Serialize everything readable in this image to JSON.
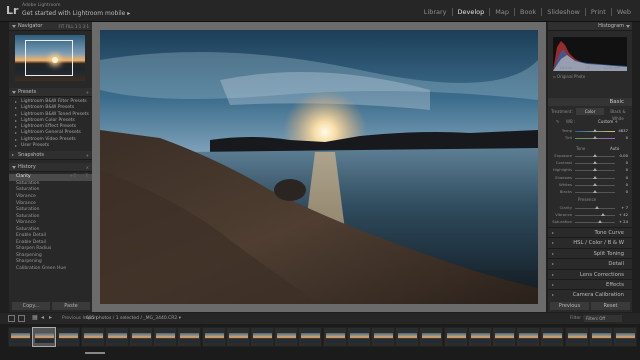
{
  "app": {
    "logo": "Lr",
    "brand_small": "Adobe Lightroom",
    "brand_title": "Get started with Lightroom mobile  ▸"
  },
  "modules": [
    "Library",
    "Develop",
    "Map",
    "Book",
    "Slideshow",
    "Print",
    "Web"
  ],
  "active_module": "Develop",
  "left_panel": {
    "navigator": {
      "title": "Navigator",
      "options": "FIT  FILL  1:1  3:1"
    },
    "presets": {
      "title": "Presets",
      "items": [
        "Lightroom B&W Filter Presets",
        "Lightroom B&W Presets",
        "Lightroom B&W Toned Presets",
        "Lightroom Color Presets",
        "Lightroom Effect Presets",
        "Lightroom General Presets",
        "Lightroom Video Presets",
        "User Presets"
      ]
    },
    "snapshots": {
      "title": "Snapshots"
    },
    "history": {
      "title": "History",
      "items": [
        {
          "label": "Clarity",
          "v1": "+7",
          "v2": "7",
          "selected": true
        },
        {
          "label": "Saturation",
          "v1": "",
          "v2": ""
        },
        {
          "label": "Saturation",
          "v1": "",
          "v2": ""
        },
        {
          "label": "Vibrance",
          "v1": "",
          "v2": ""
        },
        {
          "label": "Vibrance",
          "v1": "",
          "v2": ""
        },
        {
          "label": "Saturation",
          "v1": "",
          "v2": ""
        },
        {
          "label": "Saturation",
          "v1": "",
          "v2": ""
        },
        {
          "label": "Vibrance",
          "v1": "",
          "v2": ""
        },
        {
          "label": "Saturation",
          "v1": "",
          "v2": ""
        },
        {
          "label": "Enable Detail",
          "v1": "",
          "v2": ""
        },
        {
          "label": "Enable Detail",
          "v1": "",
          "v2": ""
        },
        {
          "label": "Sharpen Radius",
          "v1": "",
          "v2": ""
        },
        {
          "label": "Sharpening",
          "v1": "",
          "v2": ""
        },
        {
          "label": "Sharpening",
          "v1": "",
          "v2": ""
        },
        {
          "label": "Calibration Green Hue",
          "v1": "",
          "v2": ""
        }
      ]
    },
    "copy_button": "Copy...",
    "paste_button": "Paste"
  },
  "right_panel": {
    "histogram_title": "Histogram",
    "histogram_meta": [
      "16 mm",
      "f/5",
      "1/250 sec"
    ],
    "original_photo": "Original Photo",
    "basic_title": "Basic",
    "treatment_tabs": [
      "Treatment:",
      "Color",
      "Black & White"
    ],
    "wb_label": "WB :",
    "wb_value": "Custom ÷",
    "temp": {
      "label": "Temp",
      "value": "4837"
    },
    "tint": {
      "label": "Tint",
      "value": "0"
    },
    "tone_label": "Tone",
    "auto_label": "Auto",
    "tone_sliders": [
      {
        "label": "Exposure",
        "value": "0.00",
        "pos": 0.5
      },
      {
        "label": "Contrast",
        "value": "0",
        "pos": 0.5
      },
      {
        "label": "Highlights",
        "value": "0",
        "pos": 0.5
      },
      {
        "label": "Shadows",
        "value": "0",
        "pos": 0.5
      },
      {
        "label": "Whites",
        "value": "0",
        "pos": 0.5
      },
      {
        "label": "Blacks",
        "value": "0",
        "pos": 0.5
      }
    ],
    "presence_label": "Presence",
    "presence_sliders": [
      {
        "label": "Clarity",
        "value": "+ 7",
        "pos": 0.55
      },
      {
        "label": "Vibrance",
        "value": "+ 42",
        "pos": 0.7
      },
      {
        "label": "Saturation",
        "value": "+ 24",
        "pos": 0.62
      }
    ],
    "sections": [
      "Tone Curve",
      "HSL  /  Color  /  B & W",
      "Split Toning",
      "Detail",
      "Lens Corrections",
      "Effects",
      "Camera Calibration"
    ],
    "previous_button": "Previous",
    "reset_button": "Reset"
  },
  "filmstrip_bar": {
    "previous_import": "Previous Import",
    "source": "685 photos / 1 selected / _MG_3440.CR2 ▾",
    "filter_label": "Filter :",
    "filter_value": "Filters Off"
  },
  "filmstrip": {
    "count": 26,
    "selected_index": 1
  }
}
